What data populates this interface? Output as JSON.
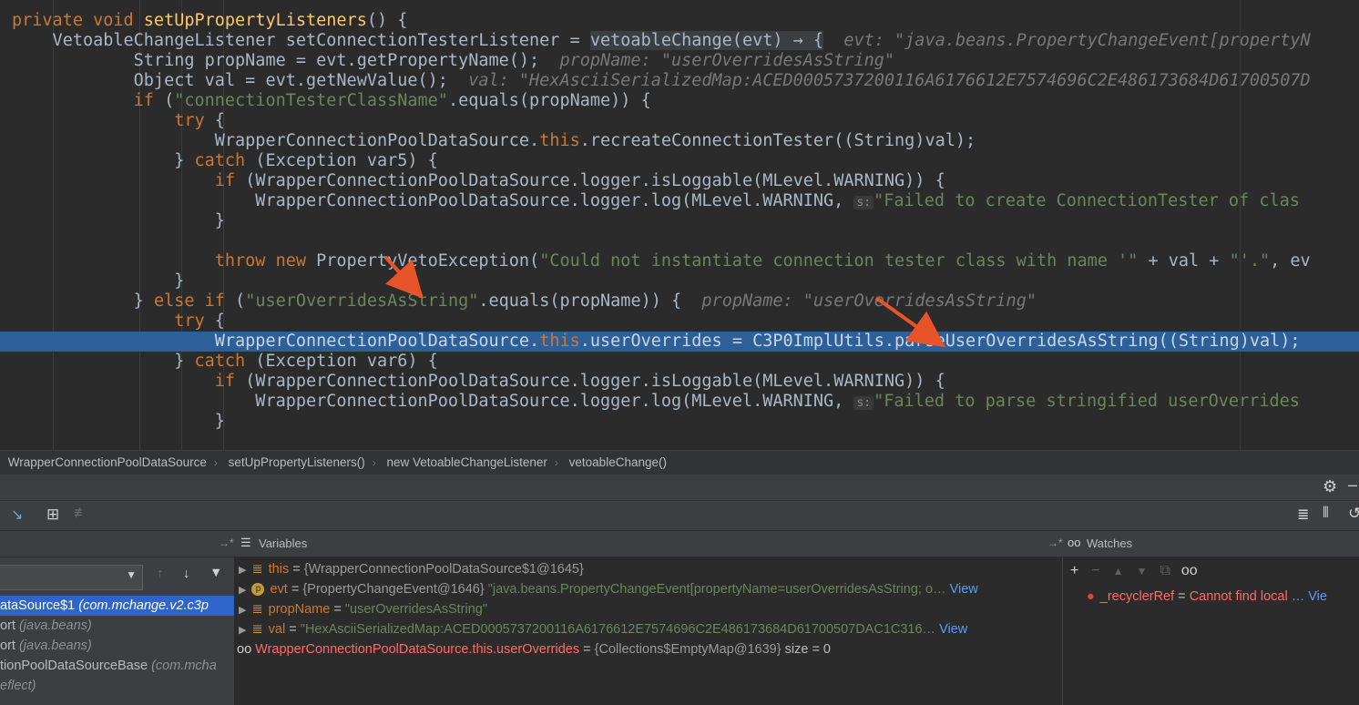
{
  "editor": {
    "lines": [
      [
        [
          "kw",
          "private void "
        ],
        [
          "fn",
          "setUpPropertyListeners"
        ],
        [
          "pl",
          "() {"
        ]
      ],
      [
        [
          "pl",
          "    VetoableChangeListener setConnectionTesterListener = "
        ],
        [
          "hl",
          "vetoableChange(evt) → {"
        ],
        [
          "hint",
          "  evt: \"java.beans.PropertyChangeEvent[propertyN"
        ]
      ],
      [
        [
          "pl",
          "            String propName = evt.getPropertyName();"
        ],
        [
          "hint",
          "  propName: \"userOverridesAsString\""
        ]
      ],
      [
        [
          "pl",
          "            Object val = evt.getNewValue();"
        ],
        [
          "hint",
          "  val: \"HexAsciiSerializedMap:ACED0005737200116A6176612E7574696C2E486173684D61700507D"
        ]
      ],
      [
        [
          "kw",
          "            if "
        ],
        [
          "pl",
          "("
        ],
        [
          "str",
          "\"connectionTesterClassName\""
        ],
        [
          "pl",
          ".equals(propName)) {"
        ]
      ],
      [
        [
          "kw",
          "                try "
        ],
        [
          "pl",
          "{"
        ]
      ],
      [
        [
          "pl",
          "                    WrapperConnectionPoolDataSource."
        ],
        [
          "kw",
          "this"
        ],
        [
          "pl",
          ".recreateConnectionTester((String)val);"
        ]
      ],
      [
        [
          "pl",
          "                } "
        ],
        [
          "kw",
          "catch "
        ],
        [
          "pl",
          "(Exception var5) {"
        ]
      ],
      [
        [
          "kw",
          "                    if "
        ],
        [
          "pl",
          "(WrapperConnectionPoolDataSource.logger.isLoggable(MLevel.WARNING)) {"
        ]
      ],
      [
        [
          "pl",
          "                        WrapperConnectionPoolDataSource.logger.log(MLevel.WARNING, "
        ],
        [
          "chip",
          "s:"
        ],
        [
          "str",
          "\"Failed to create ConnectionTester of clas"
        ]
      ],
      [
        [
          "pl",
          "                    }"
        ]
      ],
      [
        [
          "pl",
          ""
        ]
      ],
      [
        [
          "kw",
          "                    throw new "
        ],
        [
          "pl",
          "PropertyVetoException("
        ],
        [
          "str",
          "\"Could not instantiate connection tester class with name '\""
        ],
        [
          "pl",
          " + val + "
        ],
        [
          "str",
          "\"'.\""
        ],
        [
          "pl",
          ", ev"
        ]
      ],
      [
        [
          "pl",
          "                }"
        ]
      ],
      [
        [
          "pl",
          "            } "
        ],
        [
          "kw",
          "else if "
        ],
        [
          "pl",
          "("
        ],
        [
          "str",
          "\"userOverridesAsString\""
        ],
        [
          "pl",
          ".equals(propName)) {"
        ],
        [
          "hint",
          "  propName: \"userOverridesAsString\""
        ]
      ],
      [
        [
          "kw",
          "                try "
        ],
        [
          "pl",
          "{"
        ]
      ],
      [
        [
          "pl",
          "                    WrapperConnectionPoolDataSource."
        ],
        [
          "kw",
          "this"
        ],
        [
          "pl",
          ".userOverrides = C3P0ImplUtils.parseUserOverridesAsString((String)val);"
        ]
      ],
      [
        [
          "pl",
          "                } "
        ],
        [
          "kw",
          "catch "
        ],
        [
          "pl",
          "(Exception var6) {"
        ]
      ],
      [
        [
          "kw",
          "                    if "
        ],
        [
          "pl",
          "(WrapperConnectionPoolDataSource.logger.isLoggable(MLevel.WARNING)) {"
        ]
      ],
      [
        [
          "pl",
          "                        WrapperConnectionPoolDataSource.logger.log(MLevel.WARNING, "
        ],
        [
          "chip",
          "s:"
        ],
        [
          "str",
          "\"Failed to parse stringified userOverrides"
        ]
      ],
      [
        [
          "pl",
          "                    }"
        ]
      ]
    ],
    "exec_line_index": 16
  },
  "breadcrumb": [
    "WrapperConnectionPoolDataSource",
    "setUpPropertyListeners()",
    "new VetoableChangeListener",
    "vetoableChange()"
  ],
  "panels": {
    "variables_title": "Variables",
    "watches_title": "Watches"
  },
  "frames": [
    {
      "name": "ataSource$1",
      "pkg": "(com.mchange.v2.c3p",
      "selected": true
    },
    {
      "name": "ort",
      "pkg": "(java.beans)",
      "selected": false
    },
    {
      "name": "ort",
      "pkg": "(java.beans)",
      "selected": false
    },
    {
      "name": "tionPoolDataSourceBase",
      "pkg": "(com.mcha",
      "selected": false
    },
    {
      "name": "",
      "pkg": "eflect)",
      "selected": false
    }
  ],
  "variables": [
    {
      "icon": "field",
      "name": "this",
      "value": "{WrapperConnectionPoolDataSource$1@1645}",
      "extra": "",
      "view": ""
    },
    {
      "icon": "param",
      "name": "evt",
      "value": "{PropertyChangeEvent@1646}",
      "extra": "\"java.beans.PropertyChangeEvent[propertyName=userOverridesAsString; o…",
      "view": "View"
    },
    {
      "icon": "field",
      "name": "propName",
      "value": "\"userOverridesAsString\"",
      "extra": "",
      "view": ""
    },
    {
      "icon": "field",
      "name": "val",
      "value": "\"HexAsciiSerializedMap:ACED0005737200116A6176612E7574696C2E486173684D61700507DAC1C316…",
      "extra": "",
      "view": "View"
    },
    {
      "icon": "watch",
      "name": "WrapperConnectionPoolDataSource.this.userOverrides",
      "value": "{Collections$EmptyMap@1639}",
      "extra": "size = 0",
      "view": ""
    }
  ],
  "watches": [
    {
      "name": "_recyclerRef",
      "value": "Cannot find local",
      "more": "… Vie"
    }
  ],
  "colors": {
    "exec_line": "#2d6099",
    "keyword": "#cc7832",
    "string": "#6a8759",
    "arrow": "#e8542a"
  }
}
